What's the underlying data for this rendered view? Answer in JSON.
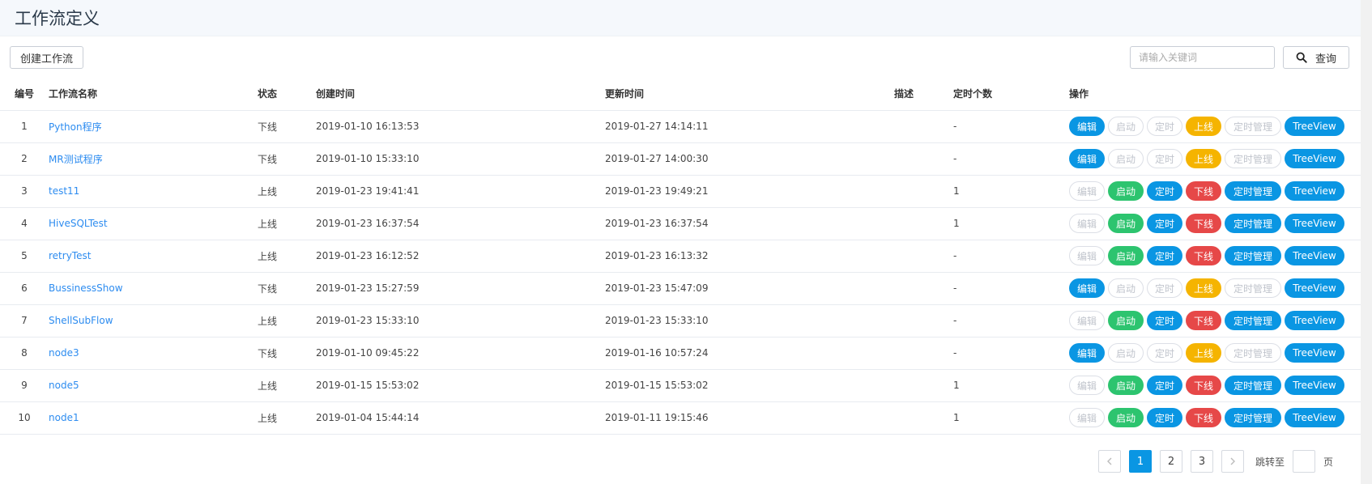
{
  "page": {
    "title": "工作流定义"
  },
  "toolbar": {
    "create_label": "创建工作流",
    "search_placeholder": "请输入关键词",
    "query_label": "查询"
  },
  "columns": [
    "编号",
    "工作流名称",
    "状态",
    "创建时间",
    "更新时间",
    "描述",
    "定时个数",
    "操作"
  ],
  "ops_labels": {
    "edit": "编辑",
    "start": "启动",
    "timer": "定时",
    "online": "上线",
    "offline": "下线",
    "timer_manage": "定时管理",
    "tree_view": "TreeView"
  },
  "rows": [
    {
      "id": "1",
      "name": "Python程序",
      "status": "下线",
      "created": "2019-01-10 16:13:53",
      "updated": "2019-01-27 14:14:11",
      "desc": "",
      "timer_count": "-"
    },
    {
      "id": "2",
      "name": "MR测试程序",
      "status": "下线",
      "created": "2019-01-10 15:33:10",
      "updated": "2019-01-27 14:00:30",
      "desc": "",
      "timer_count": "-"
    },
    {
      "id": "3",
      "name": "test11",
      "status": "上线",
      "created": "2019-01-23 19:41:41",
      "updated": "2019-01-23 19:49:21",
      "desc": "",
      "timer_count": "1"
    },
    {
      "id": "4",
      "name": "HiveSQLTest",
      "status": "上线",
      "created": "2019-01-23 16:37:54",
      "updated": "2019-01-23 16:37:54",
      "desc": "",
      "timer_count": "1"
    },
    {
      "id": "5",
      "name": "retryTest",
      "status": "上线",
      "created": "2019-01-23 16:12:52",
      "updated": "2019-01-23 16:13:32",
      "desc": "",
      "timer_count": "-"
    },
    {
      "id": "6",
      "name": "BussinessShow",
      "status": "下线",
      "created": "2019-01-23 15:27:59",
      "updated": "2019-01-23 15:47:09",
      "desc": "",
      "timer_count": "-"
    },
    {
      "id": "7",
      "name": "ShellSubFlow",
      "status": "上线",
      "created": "2019-01-23 15:33:10",
      "updated": "2019-01-23 15:33:10",
      "desc": "",
      "timer_count": "-"
    },
    {
      "id": "8",
      "name": "node3",
      "status": "下线",
      "created": "2019-01-10 09:45:22",
      "updated": "2019-01-16 10:57:24",
      "desc": "",
      "timer_count": "-"
    },
    {
      "id": "9",
      "name": "node5",
      "status": "上线",
      "created": "2019-01-15 15:53:02",
      "updated": "2019-01-15 15:53:02",
      "desc": "",
      "timer_count": "1"
    },
    {
      "id": "10",
      "name": "node1",
      "status": "上线",
      "created": "2019-01-04 15:44:14",
      "updated": "2019-01-11 19:15:46",
      "desc": "",
      "timer_count": "1"
    }
  ],
  "pagination": {
    "pages": [
      "1",
      "2",
      "3"
    ],
    "current": "1",
    "jump_label": "跳转至",
    "page_suffix": "页"
  },
  "colors": {
    "primary": "#0a96e3",
    "success": "#2dc46f",
    "danger": "#e64848",
    "warning": "#f5b400",
    "link": "#2d8cf0"
  },
  "icons": {
    "search": "search-icon",
    "prev": "chevron-left-icon",
    "next": "chevron-right-icon"
  }
}
